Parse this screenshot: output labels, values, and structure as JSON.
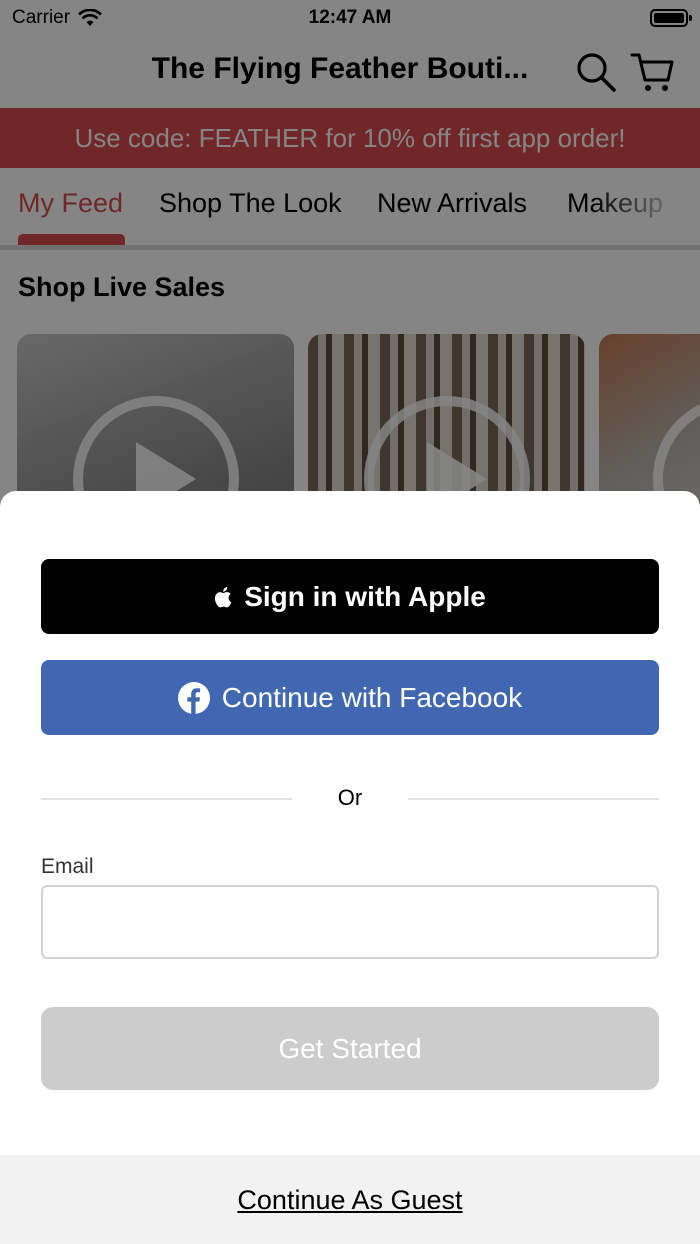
{
  "status_bar": {
    "carrier": "Carrier",
    "time": "12:47 AM",
    "icons": [
      "wifi-icon",
      "battery-icon"
    ]
  },
  "header": {
    "title": "The Flying Feather Bouti...",
    "icons": [
      "search-icon",
      "cart-icon"
    ]
  },
  "promo": {
    "text": "Use code: FEATHER for 10% off first app order!",
    "color": "#d94c4c"
  },
  "tabs": [
    {
      "label": "My Feed",
      "active": true
    },
    {
      "label": "Shop The Look",
      "active": false
    },
    {
      "label": "New Arrivals",
      "active": false
    },
    {
      "label": "Makeup",
      "active": false
    }
  ],
  "section": {
    "title": "Shop Live Sales",
    "cards_icon": "play-icon"
  },
  "sign_in_sheet": {
    "apple_button": "Sign in with Apple",
    "facebook_button": "Continue with Facebook",
    "or_text": "Or",
    "email_label": "Email",
    "email_value": "",
    "email_placeholder": "",
    "get_started_button": "Get Started",
    "guest_link": "Continue As Guest",
    "colors": {
      "apple": "#000000",
      "facebook": "#4267b2",
      "disabled_button": "#cccccc"
    }
  }
}
